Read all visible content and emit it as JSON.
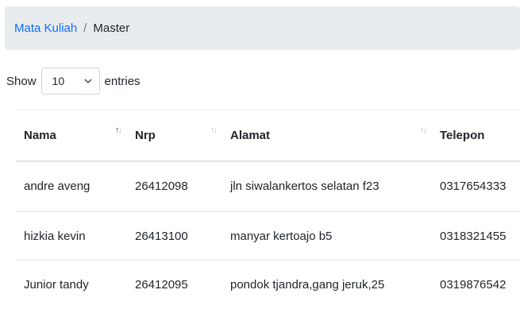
{
  "breadcrumb": {
    "link": "Mata Kuliah",
    "separator": "/",
    "current": "Master"
  },
  "length_menu": {
    "prefix": "Show",
    "selected": "10",
    "suffix": "entries"
  },
  "table": {
    "columns": [
      {
        "label": "Nama",
        "sorted": true
      },
      {
        "label": "Nrp",
        "sorted": false
      },
      {
        "label": "Alamat",
        "sorted": false
      },
      {
        "label": "Telepon",
        "sorted": false
      }
    ],
    "rows": [
      [
        "andre aveng",
        "26412098",
        "jln siwalankertos selatan f23",
        "0317654333"
      ],
      [
        "hizkia kevin",
        "26413100",
        "manyar kertoajo b5",
        "0318321455"
      ],
      [
        "Junior tandy",
        "26412095",
        "pondok tjandra,gang jeruk,25",
        "0319876542"
      ]
    ]
  },
  "colors": {
    "link": "#0d6efd",
    "breadcrumb_bg": "#e9ecef"
  }
}
